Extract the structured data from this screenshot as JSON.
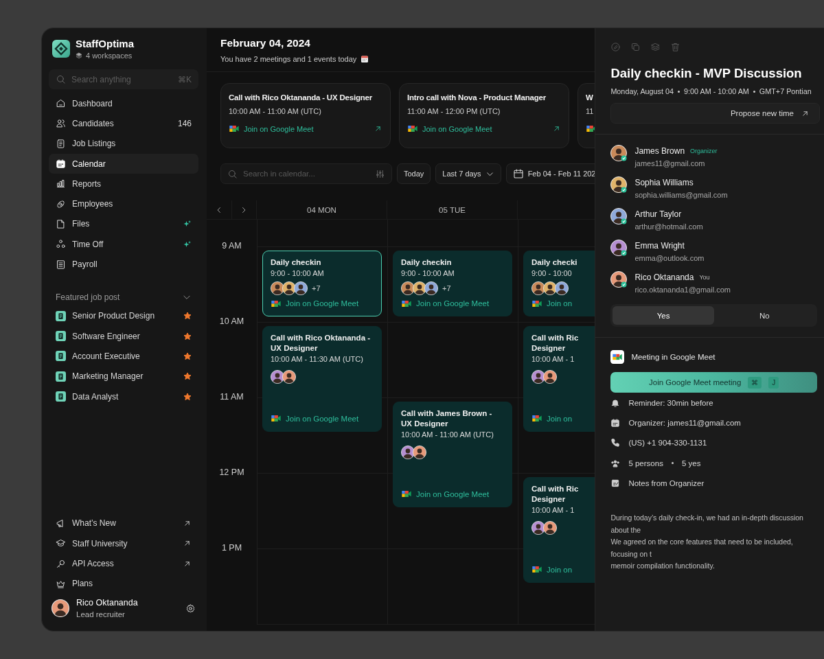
{
  "app": {
    "name": "StaffOptima",
    "workspaces": "4 workspaces"
  },
  "search": {
    "placeholder": "Search anything",
    "shortcut": "⌘K"
  },
  "nav": [
    {
      "label": "Dashboard",
      "selected": false,
      "new": false
    },
    {
      "label": "Candidates",
      "count": "146",
      "selected": false,
      "new": false
    },
    {
      "label": "Job Listings",
      "selected": false,
      "new": false
    },
    {
      "label": "Calendar",
      "selected": true,
      "new": false
    },
    {
      "label": "Reports",
      "selected": false,
      "new": false
    },
    {
      "label": "Employees",
      "selected": false,
      "new": false
    },
    {
      "label": "Files",
      "selected": false,
      "new": true
    },
    {
      "label": "Time Off",
      "selected": false,
      "new": true
    },
    {
      "label": "Payroll",
      "selected": false,
      "new": false
    }
  ],
  "featured": {
    "title": "Featured job post",
    "expanded": true,
    "jobs": [
      {
        "label": "Senior Product Design",
        "starred": true
      },
      {
        "label": "Software Engineer",
        "starred": true
      },
      {
        "label": "Account Executive",
        "starred": true
      },
      {
        "label": "Marketing Manager",
        "starred": true
      },
      {
        "label": "Data Analyst",
        "starred": true
      }
    ]
  },
  "links": [
    {
      "label": "What’s New",
      "external": true
    },
    {
      "label": "Staff University",
      "external": true
    },
    {
      "label": "API Access",
      "external": true
    },
    {
      "label": "Plans",
      "external": false
    }
  ],
  "user": {
    "name": "Rico Oktananda",
    "role": "Lead recruiter"
  },
  "header": {
    "date": "February 04, 2024",
    "summary": "You have 2 meetings and 1 events today"
  },
  "meetings": [
    {
      "title": "Call with Rico Oktananda - UX Designer",
      "time": "10:00 AM - 11:00 AM (UTC)",
      "link": "Join on Google Meet"
    },
    {
      "title": "Intro call with Nova - Product Manager",
      "time": "11:00 AM - 12:00 PM (UTC)",
      "link": "Join on Google Meet"
    },
    {
      "title": "W",
      "time": "11"
    }
  ],
  "toolbar": {
    "search_placeholder": "Search in calendar...",
    "today": "Today",
    "range": "Last 7 days",
    "dates": "Feb 04 - Feb 11 202"
  },
  "calendar": {
    "hours": [
      "9 AM",
      "10 AM",
      "11 AM",
      "12 PM",
      "1 PM"
    ],
    "days": [
      {
        "label": "04 MON",
        "slots": [
          {
            "kind": "short",
            "title": "Daily checkin",
            "time": "9:00 - 10:00 AM",
            "extra": "+7",
            "link": "Join on Google Meet",
            "selected": true
          },
          {
            "kind": "long",
            "title": "Call with Rico Oktananda - UX Designer",
            "time": "10:00 AM - 11:30 AM (UTC)",
            "link": "Join on Google Meet",
            "selected": false
          },
          {
            "kind": "empty"
          },
          {
            "kind": "empty"
          },
          {
            "kind": "empty"
          }
        ]
      },
      {
        "label": "05 TUE",
        "slots": [
          {
            "kind": "short",
            "title": "Daily checkin",
            "time": "9:00 - 10:00 AM",
            "extra": "+7",
            "link": "Join on Google Meet",
            "selected": false
          },
          {
            "kind": "empty"
          },
          {
            "kind": "long",
            "title": "Call with James Brown - UX Designer",
            "time": "10:00 AM - 11:00 AM (UTC)",
            "link": "Join on Google Meet",
            "selected": false
          },
          {
            "kind": "empty"
          },
          {
            "kind": "empty"
          }
        ]
      },
      {
        "slots": [
          {
            "kind": "short",
            "title": "Daily checki",
            "time": "9:00 - 10:00",
            "link": "Join on",
            "selected": false
          },
          {
            "kind": "long",
            "title": "Call with Ric Designer",
            "time": "10:00 AM - 1",
            "link": "Join on",
            "selected": false
          },
          {
            "kind": "empty"
          },
          {
            "kind": "long",
            "title": "Call with Ric Designer",
            "time": "10:00 AM - 1",
            "link": "Join on",
            "selected": false
          },
          {
            "kind": "empty"
          }
        ]
      }
    ]
  },
  "panel": {
    "title": "Daily checkin - MVP Discussion",
    "date": "Monday, August 04",
    "time": "9:00 AM - 10:00 AM",
    "zone": "GMT+7 Pontian",
    "propose": "Propose new time",
    "attendees": [
      {
        "name": "James Brown",
        "tag": {
          "kind": "organizer",
          "text": "Organizer"
        },
        "email": "james11@gmail.com",
        "accepted": true
      },
      {
        "name": "Sophia Williams",
        "email": "sophia.williams@gmail.com",
        "accepted": true
      },
      {
        "name": "Arthur Taylor",
        "email": "arthur@hotmail.com",
        "accepted": true
      },
      {
        "name": "Emma Wright",
        "email": "emma@outlook.com",
        "accepted": true
      },
      {
        "name": "Rico Oktananda",
        "tag": {
          "kind": "you",
          "text": "You"
        },
        "email": "rico.oktananda1@gmail.com",
        "accepted": true
      }
    ],
    "rsvp": [
      {
        "label": "Yes",
        "selected": true
      },
      {
        "label": "No",
        "selected": false
      }
    ],
    "meet": {
      "label": "Meeting in Google Meet",
      "button": "Join Google Meet meeting",
      "keys": [
        "⌘",
        "J"
      ]
    },
    "details": [
      {
        "kind": "reminder",
        "parts": [
          "Reminder: 30min before"
        ]
      },
      {
        "kind": "organizer",
        "parts": [
          "Organizer: james11@gmail.com"
        ]
      },
      {
        "kind": "phone",
        "parts": [
          "(US) +1 904-330-1131"
        ]
      },
      {
        "kind": "people",
        "parts": [
          "5 persons",
          "5 yes"
        ]
      },
      {
        "kind": "notes",
        "parts": [
          "Notes from Organizer"
        ]
      }
    ],
    "notes": "During today’s daily check-in, we had an in-depth discussion about the\nWe agreed on the core features that need to be included, focusing on t\nmemoir compilation functionality."
  }
}
